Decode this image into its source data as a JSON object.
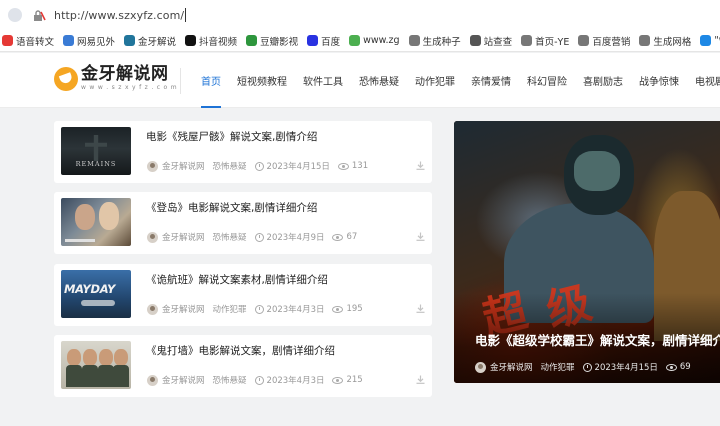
{
  "browser": {
    "url": "http://www.szxyfz.com/",
    "bookmarks": [
      {
        "label": "语音转文",
        "icon": "speech-icon",
        "color": "#e53935"
      },
      {
        "label": "网易见外",
        "icon": "netease-icon",
        "color": "#3a7bd5"
      },
      {
        "label": "金牙解说",
        "icon": "wordpress-icon",
        "color": "#21759b"
      },
      {
        "label": "抖音视频",
        "icon": "douyin-icon",
        "color": "#111111"
      },
      {
        "label": "豆瓣影视",
        "icon": "douban-icon",
        "color": "#2e963d"
      },
      {
        "label": "百度",
        "icon": "baidu-icon",
        "color": "#2932e1"
      },
      {
        "label": "www.zg",
        "icon": "site-icon",
        "color": "#4caf50"
      },
      {
        "label": "生成种子",
        "icon": "globe-icon",
        "color": "#777777"
      },
      {
        "label": "站查查",
        "icon": "cloud-icon",
        "color": "#555555"
      },
      {
        "label": "首页-YE",
        "icon": "globe-icon",
        "color": "#777777"
      },
      {
        "label": "百度营销",
        "icon": "globe-icon",
        "color": "#777777"
      },
      {
        "label": "生成网格",
        "icon": "globe-icon",
        "color": "#777777"
      },
      {
        "label": "\"www.fe",
        "icon": "page-icon",
        "color": "#1e88e5"
      }
    ]
  },
  "site": {
    "logo_title": "金牙解说网",
    "logo_subtitle": "w w w . s z x y f z . c o m",
    "brand_color": "#f5a623",
    "accent_color": "#1e73d6",
    "nav": [
      {
        "label": "首页",
        "active": true
      },
      {
        "label": "短视频教程",
        "active": false
      },
      {
        "label": "软件工具",
        "active": false
      },
      {
        "label": "恐怖悬疑",
        "active": false
      },
      {
        "label": "动作犯罪",
        "active": false
      },
      {
        "label": "亲情爱情",
        "active": false
      },
      {
        "label": "科幻冒险",
        "active": false
      },
      {
        "label": "喜剧励志",
        "active": false
      },
      {
        "label": "战争惊悚",
        "active": false
      },
      {
        "label": "电视剧文案",
        "active": false,
        "has_dropdown": true
      }
    ]
  },
  "articles": [
    {
      "title": "电影《残屋尸骸》解说文案,剧情介绍",
      "author": "金牙解说网",
      "category": "恐怖悬疑",
      "date": "2023年4月15日",
      "views": "131",
      "thumb_label": "REMAINS"
    },
    {
      "title": "《登岛》电影解说文案,剧情详细介绍",
      "author": "金牙解说网",
      "category": "恐怖悬疑",
      "date": "2023年4月9日",
      "views": "67",
      "thumb_label": ""
    },
    {
      "title": "《诡航班》解说文案素材,剧情详细介绍",
      "author": "金牙解说网",
      "category": "动作犯罪",
      "date": "2023年4月3日",
      "views": "195",
      "thumb_label": "MAYDAY"
    },
    {
      "title": "《鬼打墙》电影解说文案，剧情详细介绍",
      "author": "金牙解说网",
      "category": "恐怖悬疑",
      "date": "2023年4月3日",
      "views": "215",
      "thumb_label": ""
    }
  ],
  "hero": {
    "title": "电影《超级学校霸王》解说文案，剧情详细介",
    "author": "金牙解说网",
    "category": "动作犯罪",
    "date": "2023年4月15日",
    "views": "69",
    "poster_chars": [
      "超",
      "级"
    ]
  }
}
